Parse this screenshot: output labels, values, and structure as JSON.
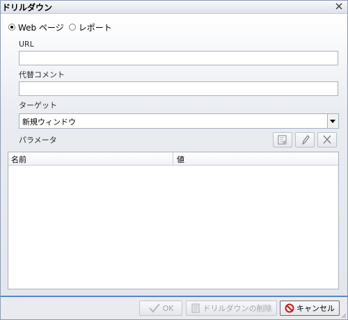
{
  "dialog": {
    "title": "ドリルダウン"
  },
  "link_type": {
    "options": [
      "Web ページ",
      "レポート"
    ],
    "selected": "Web ページ"
  },
  "url": {
    "label": "URL",
    "value": ""
  },
  "alt_comment": {
    "label": "代替コメント",
    "value": ""
  },
  "target": {
    "label": "ターゲット",
    "value": "新規ウィンドウ"
  },
  "parameters": {
    "label": "パラメータ",
    "columns": [
      "名前",
      "値"
    ],
    "rows": []
  },
  "footer": {
    "ok_label": "OK",
    "delete_label": "ドリルダウンの削除",
    "cancel_label": "キャンセル"
  },
  "colors": {
    "accent": "#5a85c8",
    "cancel_icon": "#d01818"
  }
}
